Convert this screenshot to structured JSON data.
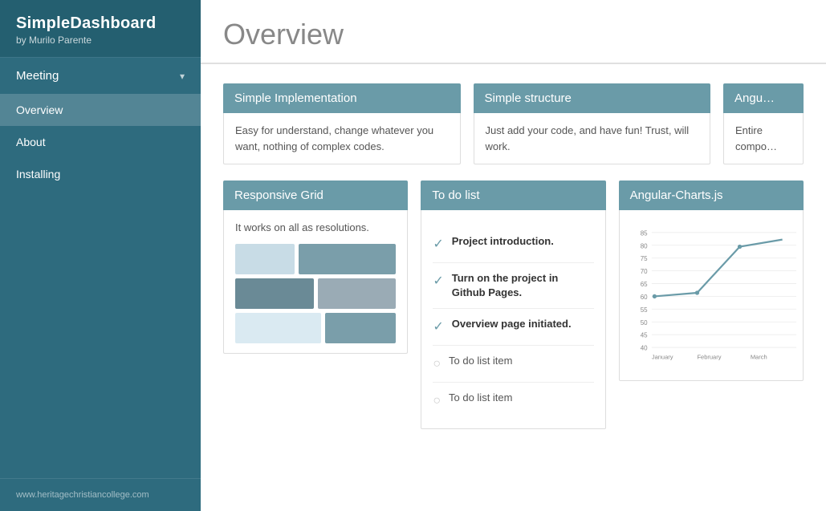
{
  "sidebar": {
    "title": "SimpleDashboard",
    "subtitle": "by Murilo Parente",
    "footer": "www.heritagechristiancollege.com",
    "nav_group": {
      "label": "Meeting",
      "arrow": "▾"
    },
    "items": [
      {
        "id": "overview",
        "label": "Overview",
        "active": true
      },
      {
        "id": "about",
        "label": "About",
        "active": false
      },
      {
        "id": "installing",
        "label": "Installing",
        "active": false
      }
    ]
  },
  "main": {
    "page_title": "Overview",
    "card_row1": [
      {
        "id": "simple-implementation",
        "header": "Simple Implementation",
        "body": "Easy for understand, change whatever you want, nothing of complex codes."
      },
      {
        "id": "simple-structure",
        "header": "Simple structure",
        "body": "Just add your code, and have fun! Trust, will work."
      },
      {
        "id": "angularjs",
        "header": "Angu…",
        "body": "Entire compo…"
      }
    ],
    "card_row2": [
      {
        "id": "responsive-grid",
        "header": "Responsive Grid",
        "body": "It works on all as resolutions."
      },
      {
        "id": "todo-list",
        "header": "To do list",
        "items": [
          {
            "done": true,
            "text": "Project introduction."
          },
          {
            "done": true,
            "text": "Turn on the project in Github Pages."
          },
          {
            "done": true,
            "text": "Overview page initiated."
          },
          {
            "done": false,
            "text": "To do list item"
          },
          {
            "done": false,
            "text": "To do list item"
          }
        ]
      },
      {
        "id": "angular-charts",
        "header": "Angular-Charts.js"
      }
    ],
    "chart": {
      "y_labels": [
        85,
        80,
        75,
        70,
        65,
        60,
        55,
        50,
        45,
        40
      ],
      "x_labels": [
        "January",
        "February",
        "March"
      ]
    }
  }
}
